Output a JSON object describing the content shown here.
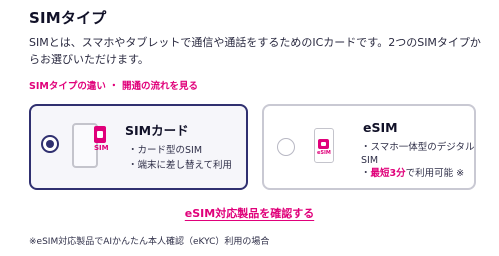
{
  "section": {
    "title": "SIMタイプ",
    "description": "SIMとは、スマホやタブレットで通信や通話をするためのICカードです。2つのSIMタイプからお選びいただけます。",
    "diff_link": "SIMタイプの違い ・ 開通の流れを見る"
  },
  "options": {
    "sim": {
      "title": "SIMカード",
      "selected": true,
      "icon_tag": "SIM",
      "features": [
        "・カード型のSIM",
        "・端末に差し替えて利用"
      ]
    },
    "esim": {
      "title": "eSIM",
      "selected": false,
      "icon_tag": "eSIM",
      "feature_line1": "・スマホ一体型のデジタル",
      "feature_line2": "SIM",
      "feature_line3_prefix": "・",
      "feature_line3_highlight": "最短3分",
      "feature_line3_suffix": "で利用可能 ※"
    }
  },
  "cta": {
    "label": "eSIM対応製品を確認する"
  },
  "footnote": "※eSIM対応製品でAIかんたん本人確認（eKYC）利用の場合",
  "colors": {
    "accent": "#e0007a",
    "navy": "#303070",
    "border_inactive": "#c9c9d3"
  }
}
